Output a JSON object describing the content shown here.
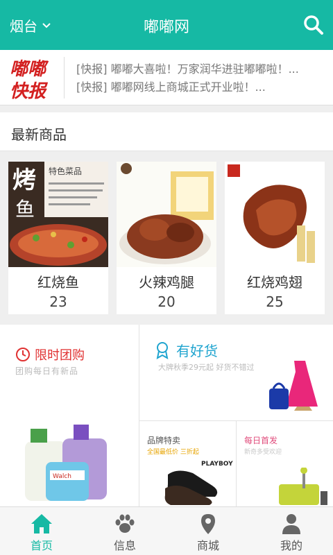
{
  "header": {
    "city": "烟台",
    "title": "嘟嘟网"
  },
  "news": {
    "logo_text_top": "嘟嘟",
    "logo_text_bottom": "快报",
    "items": [
      "[快报] 嘟嘟大喜啦！万家润华进驻嘟嘟啦！...",
      "[快报] 嘟嘟网线上商城正式开业啦！..."
    ]
  },
  "section": {
    "latest_title": "最新商品"
  },
  "products": [
    {
      "name": "红烧鱼",
      "count": "23",
      "badge_big": "烤",
      "badge_big2": "鱼",
      "badge_title": "特色菜品"
    },
    {
      "name": "火辣鸡腿",
      "count": "20"
    },
    {
      "name": "红烧鸡翅",
      "count": "25"
    }
  ],
  "promo": {
    "flash": {
      "title": "限时团购",
      "subtitle": "团购每日有新品"
    },
    "goods": {
      "title": "有好货",
      "subtitle": "大牌秋季29元起 好货不错过"
    },
    "brand": {
      "title": "品牌特卖",
      "subtitle": "全国最低价 三折起",
      "brand_text": "PLAYBOY"
    },
    "daily": {
      "title": "每日首发",
      "subtitle": "新奇多受欢迎"
    }
  },
  "tabs": [
    {
      "label": "首页",
      "icon": "home-icon",
      "active": true
    },
    {
      "label": "信息",
      "icon": "paw-icon",
      "active": false
    },
    {
      "label": "商城",
      "icon": "location-pin-icon",
      "active": false
    },
    {
      "label": "我的",
      "icon": "user-icon",
      "active": false
    }
  ],
  "colors": {
    "brand": "#16b9a4",
    "flash_red": "#e03131",
    "goods_blue": "#1fa4cf"
  }
}
